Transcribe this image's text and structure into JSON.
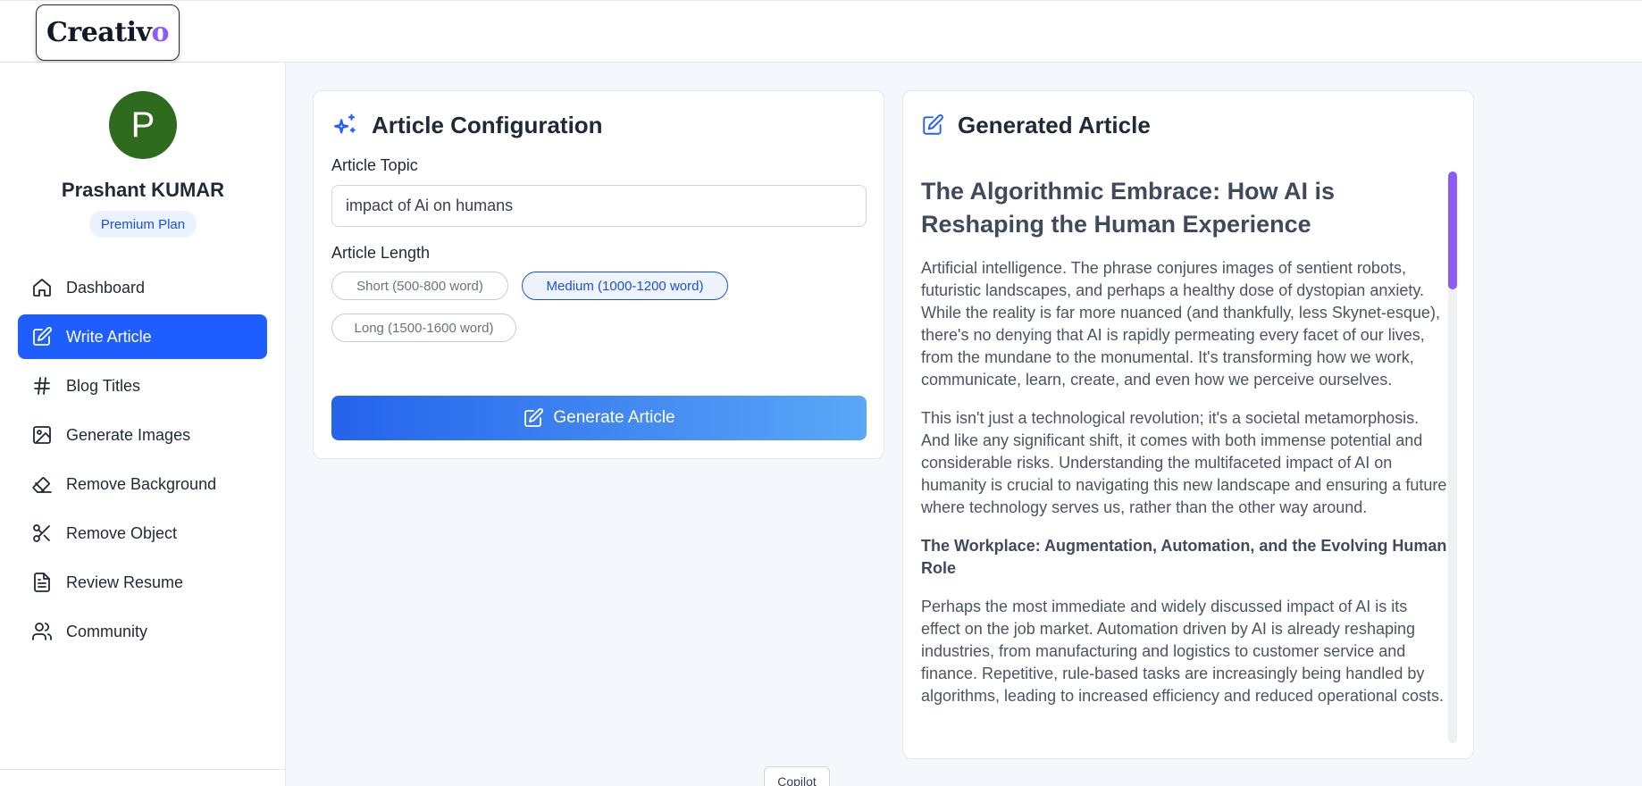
{
  "header": {
    "logo_main": "Creativ",
    "logo_accent": "o"
  },
  "user": {
    "avatar_initial": "P",
    "name": "Prashant KUMAR",
    "plan": "Premium Plan"
  },
  "nav": [
    {
      "label": "Dashboard",
      "icon": "home-icon"
    },
    {
      "label": "Write Article",
      "icon": "edit-icon",
      "active": true
    },
    {
      "label": "Blog Titles",
      "icon": "hash-icon"
    },
    {
      "label": "Generate Images",
      "icon": "image-icon"
    },
    {
      "label": "Remove Background",
      "icon": "eraser-icon"
    },
    {
      "label": "Remove Object",
      "icon": "scissors-icon"
    },
    {
      "label": "Review Resume",
      "icon": "file-text-icon"
    },
    {
      "label": "Community",
      "icon": "users-icon"
    }
  ],
  "config": {
    "title": "Article Configuration",
    "topic_label": "Article Topic",
    "topic_value": "impact of Ai on humans",
    "length_label": "Article Length",
    "lengths": [
      {
        "label": "Short (500-800 word)"
      },
      {
        "label": "Medium (1000-1200 word)",
        "selected": true
      },
      {
        "label": "Long (1500-1600 word)"
      }
    ],
    "generate_label": "Generate Article"
  },
  "article": {
    "panel_title": "Generated Article",
    "heading": "The Algorithmic Embrace: How AI is Reshaping the Human Experience",
    "p1": "Artificial intelligence. The phrase conjures images of sentient robots, futuristic landscapes, and perhaps a healthy dose of dystopian anxiety. While the reality is far more nuanced (and thankfully, less Skynet-esque), there's no denying that AI is rapidly permeating every facet of our lives, from the mundane to the monumental. It's transforming how we work, communicate, learn, create, and even how we perceive ourselves.",
    "p2": "This isn't just a technological revolution; it's a societal metamorphosis. And like any significant shift, it comes with both immense potential and considerable risks. Understanding the multifaceted impact of AI on humanity is crucial to navigating this new landscape and ensuring a future where technology serves us, rather than the other way around.",
    "subheading": "The Workplace: Augmentation, Automation, and the Evolving Human Role",
    "p3": "Perhaps the most immediate and widely discussed impact of AI is its effect on the job market. Automation driven by AI is already reshaping industries, from manufacturing and logistics to customer service and finance. Repetitive, rule-based tasks are increasingly being handled by algorithms, leading to increased efficiency and reduced operational costs."
  },
  "footer": {
    "copilot_label": "Copilot"
  },
  "colors": {
    "primary": "#1e5eff",
    "accent": "#8b5cf6",
    "avatar": "#2f6b1f"
  }
}
